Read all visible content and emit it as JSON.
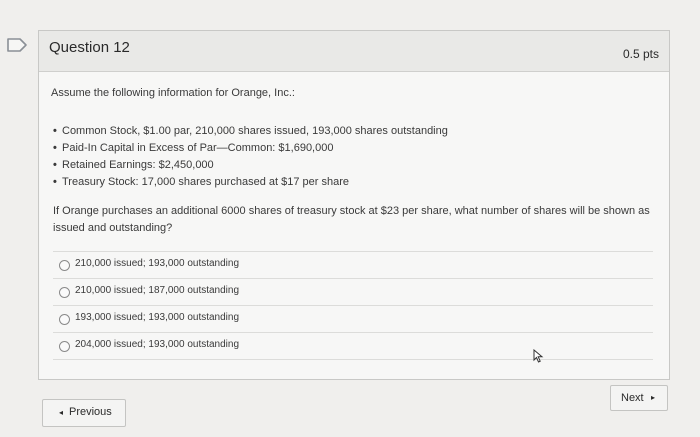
{
  "question": {
    "title": "Question 12",
    "points": "0.5 pts",
    "intro": "Assume the following information for Orange, Inc.:",
    "bullets": [
      "Common Stock, $1.00 par, 210,000 shares issued, 193,000 shares outstanding",
      "Paid-In Capital in Excess of Par—Common: $1,690,000",
      "Retained Earnings: $2,450,000",
      "Treasury Stock: 17,000 shares purchased at $17 per share"
    ],
    "prompt": "If Orange purchases an additional 6000 shares of treasury stock at $23 per share, what number of shares will be shown as issued and outstanding?",
    "answers": [
      "210,000 issued; 193,000 outstanding",
      "210,000 issued; 187,000 outstanding",
      "193,000 issued; 193,000 outstanding",
      "204,000 issued; 193,000 outstanding"
    ]
  },
  "nav": {
    "next_label": "Next",
    "previous_label": "Previous",
    "next_icon": "triangle-right-icon",
    "previous_icon": "triangle-left-icon"
  },
  "icons": {
    "flag": "bookmark-flag-icon",
    "cursor": "mouse-pointer-icon"
  }
}
